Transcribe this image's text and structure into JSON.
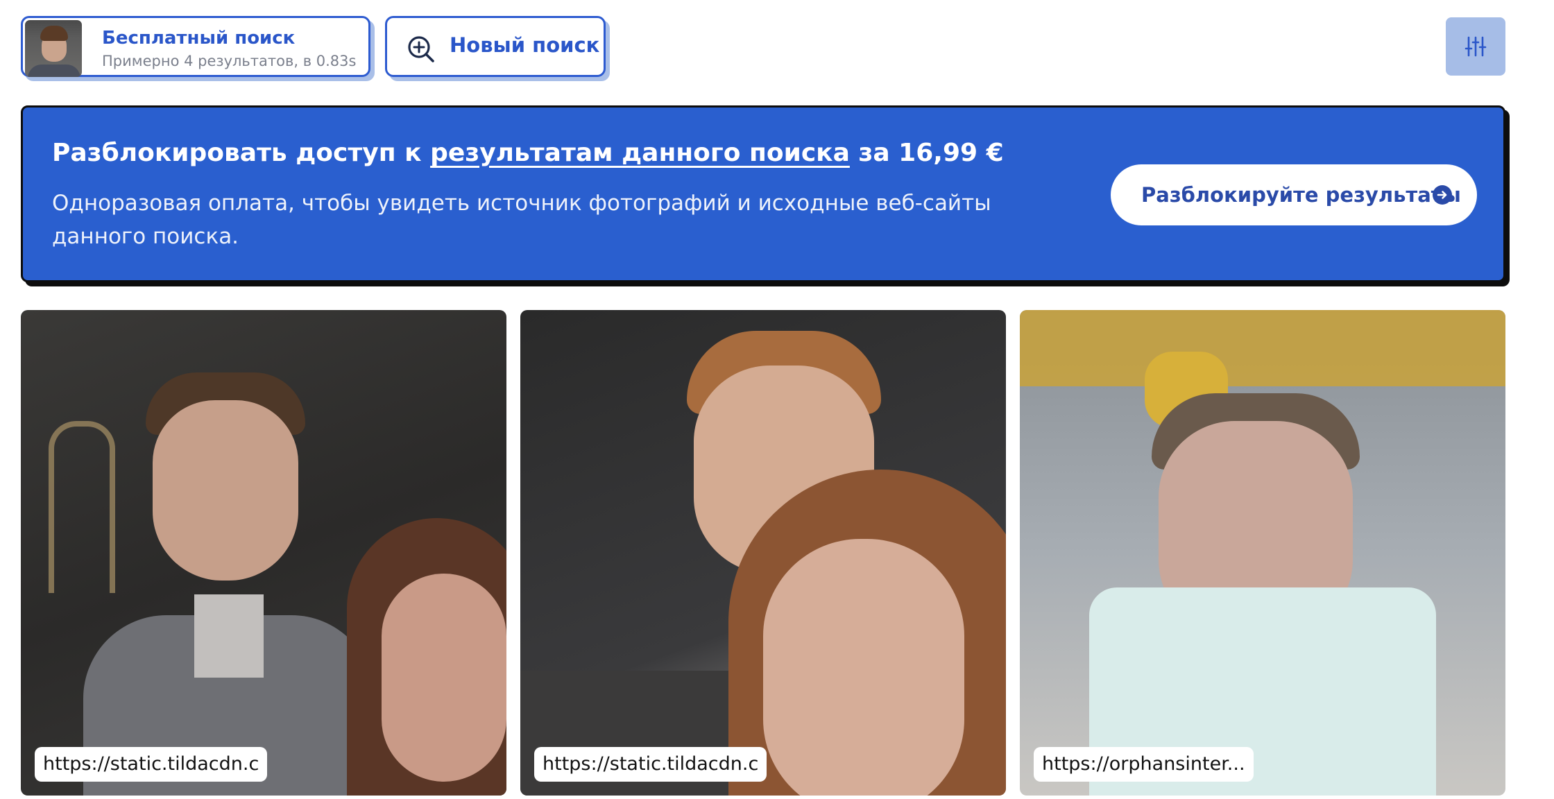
{
  "header": {
    "search_title": "Бесплатный поиск",
    "search_subtitle": "Примерно 4 результатов, в 0.83s",
    "new_search_label": "Новый поиск",
    "thumb_icon": "user-photo",
    "new_search_icon": "zoom-plus-icon",
    "filter_icon": "sliders-icon"
  },
  "banner": {
    "title_prefix": "Разблокировать доступ к ",
    "title_link": "результатам данного поиска",
    "title_suffix": " за 16,99 €",
    "description": "Одноразовая оплата, чтобы увидеть источник фотографий и исходные веб-сайты данного поиска.",
    "button_label": "Разблокируйте результаты",
    "button_icon": "arrow-right-circle-icon"
  },
  "results": [
    {
      "url": "https://static.tildacdn.c"
    },
    {
      "url": "https://static.tildacdn.c"
    },
    {
      "url": "https://orphansinter..."
    }
  ],
  "colors": {
    "accent": "#2a5fcf",
    "accent_text": "#2a56c9",
    "filter_bg": "#a6bde7",
    "shadow": "#a9bfe8"
  }
}
